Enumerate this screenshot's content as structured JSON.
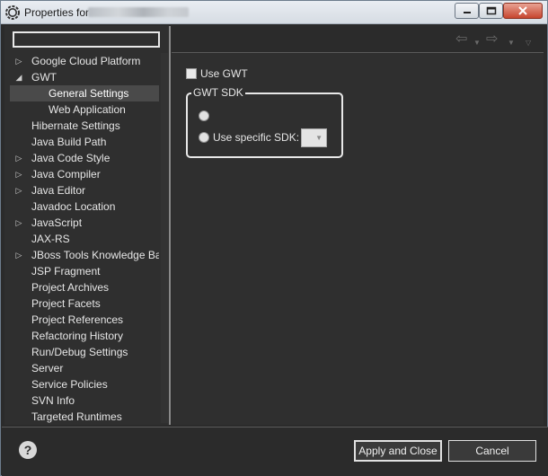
{
  "window": {
    "title": "Properties for",
    "icon": "gear-icon"
  },
  "filter": {
    "value": "",
    "placeholder": ""
  },
  "tree": [
    {
      "label": "Google Cloud Platform",
      "arrow": "▷",
      "indent": 0,
      "selected": false
    },
    {
      "label": "GWT",
      "arrow": "◢",
      "indent": 0,
      "selected": false
    },
    {
      "label": "General Settings",
      "arrow": "",
      "indent": 1,
      "selected": true
    },
    {
      "label": "Web Application",
      "arrow": "",
      "indent": 1,
      "selected": false
    },
    {
      "label": "Hibernate Settings",
      "arrow": "",
      "indent": 0,
      "selected": false
    },
    {
      "label": "Java Build Path",
      "arrow": "",
      "indent": 0,
      "selected": false
    },
    {
      "label": "Java Code Style",
      "arrow": "▷",
      "indent": 0,
      "selected": false
    },
    {
      "label": "Java Compiler",
      "arrow": "▷",
      "indent": 0,
      "selected": false
    },
    {
      "label": "Java Editor",
      "arrow": "▷",
      "indent": 0,
      "selected": false
    },
    {
      "label": "Javadoc Location",
      "arrow": "",
      "indent": 0,
      "selected": false
    },
    {
      "label": "JavaScript",
      "arrow": "▷",
      "indent": 0,
      "selected": false
    },
    {
      "label": "JAX-RS",
      "arrow": "",
      "indent": 0,
      "selected": false
    },
    {
      "label": "JBoss Tools Knowledge Ba",
      "arrow": "▷",
      "indent": 0,
      "selected": false
    },
    {
      "label": "JSP Fragment",
      "arrow": "",
      "indent": 0,
      "selected": false
    },
    {
      "label": "Project Archives",
      "arrow": "",
      "indent": 0,
      "selected": false
    },
    {
      "label": "Project Facets",
      "arrow": "",
      "indent": 0,
      "selected": false
    },
    {
      "label": "Project References",
      "arrow": "",
      "indent": 0,
      "selected": false
    },
    {
      "label": "Refactoring History",
      "arrow": "",
      "indent": 0,
      "selected": false
    },
    {
      "label": "Run/Debug Settings",
      "arrow": "",
      "indent": 0,
      "selected": false
    },
    {
      "label": "Server",
      "arrow": "",
      "indent": 0,
      "selected": false
    },
    {
      "label": "Service Policies",
      "arrow": "",
      "indent": 0,
      "selected": false
    },
    {
      "label": "SVN Info",
      "arrow": "",
      "indent": 0,
      "selected": false
    },
    {
      "label": "Targeted Runtimes",
      "arrow": "",
      "indent": 0,
      "selected": false
    }
  ],
  "nav": {
    "back_icon": "back-arrow-icon",
    "forward_icon": "forward-arrow-icon",
    "menu_icon": "view-menu-icon"
  },
  "settings": {
    "use_gwt_label": "Use GWT",
    "use_gwt_checked": false,
    "sdk_group_title": "GWT SDK",
    "option_default_label": "",
    "option_specific_label": "Use specific SDK:",
    "sdk_combo_value": ""
  },
  "buttons": {
    "apply_close": "Apply and Close",
    "cancel": "Cancel"
  },
  "colors": {
    "background": "#2b2b2b",
    "panel": "#2f2f2f",
    "selection": "#4a4a4a",
    "titlebar": "#e3e8ee",
    "close_button": "#c7462f"
  }
}
